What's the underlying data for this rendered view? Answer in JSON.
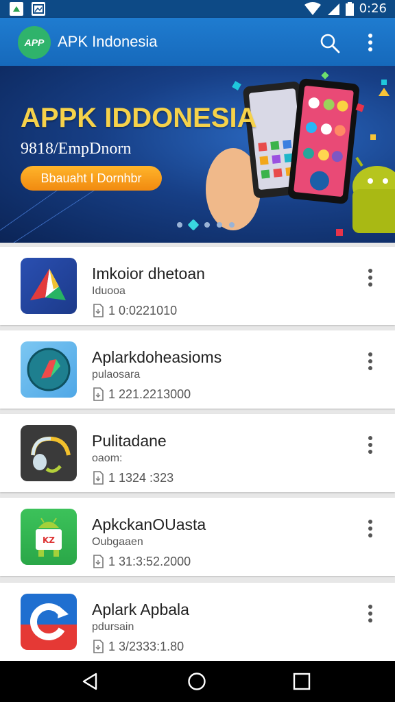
{
  "status_bar": {
    "time": "0:26",
    "left_icons": [
      "notification-icon",
      "image-icon"
    ],
    "right_icons": [
      "wifi-icon",
      "signal-icon",
      "battery-icon"
    ]
  },
  "app_bar": {
    "logo_text": "APP",
    "title": "APK Indonesia",
    "icons": [
      "search-icon",
      "more-vert-icon"
    ]
  },
  "banner": {
    "title": "APPK IDDONESIA",
    "subtitle": "9818/EmpDnorn",
    "button_label": "Bbauaht I Dornhbr",
    "slides_count": 5,
    "active_slide": 2
  },
  "apps": [
    {
      "name": "Imkoior dhetoan",
      "developer": "Iduooa",
      "meta": "1 0:0221010",
      "icon": "drive-like-icon"
    },
    {
      "name": "Aplarkdoheasioms",
      "developer": "pulaosara",
      "meta": "1 221.2213000",
      "icon": "compass-app-icon"
    },
    {
      "name": "Pulitadane",
      "developer": "oaom:",
      "meta": "1 1324 :323",
      "icon": "headset-app-icon"
    },
    {
      "name": "ApkckanOUasta",
      "developer": "Oubgaaen",
      "meta": "1 31:3:52.2000",
      "icon": "android-app-icon"
    },
    {
      "name": "Aplark Apbala",
      "developer": "pdursain",
      "meta": "1 3/2333:1.80",
      "icon": "refresh-app-icon"
    }
  ],
  "nav_bar": {
    "icons": [
      "back-icon",
      "home-icon",
      "recents-icon"
    ]
  },
  "colors": {
    "primary": "#1a70c3",
    "status_bar": "#0d4a86",
    "banner_accent": "#f6d24a",
    "button": "#f5a01d"
  }
}
